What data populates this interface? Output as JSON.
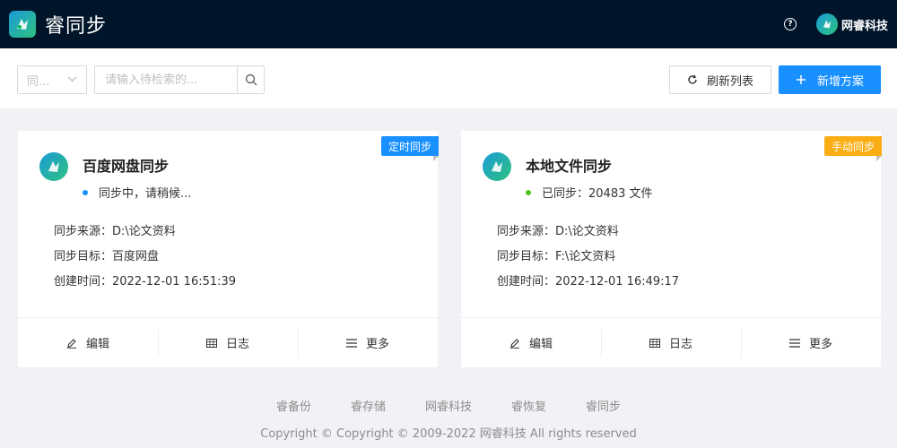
{
  "header": {
    "app_title": "睿同步",
    "logo_icon": "app-logo-icon",
    "user_name": "网睿科技"
  },
  "toolbar": {
    "select_value": "同...",
    "search_placeholder": "请输入待检索的...",
    "refresh_label": "刷新列表",
    "add_label": "新增方案"
  },
  "cards": [
    {
      "ribbon": "定时同步",
      "ribbon_color": "#1890ff",
      "title": "百度网盘同步",
      "status": "同步中，请稍候...",
      "status_color": "#1890ff",
      "source": "同步来源：D:\\论文资料",
      "target": "同步目标：百度网盘",
      "created": "创建时间：2022-12-01 16:51:39",
      "actions": {
        "edit": "编辑",
        "log": "日志",
        "more": "更多"
      }
    },
    {
      "ribbon": "手动同步",
      "ribbon_color": "#faad14",
      "title": "本地文件同步",
      "status": "已同步：20483 文件",
      "status_color": "#52c41a",
      "source": "同步来源：D:\\论文资料",
      "target": "同步目标：F:\\论文资料",
      "created": "创建时间：2022-12-01 16:49:17",
      "actions": {
        "edit": "编辑",
        "log": "日志",
        "more": "更多"
      }
    }
  ],
  "footer": {
    "links": [
      "睿备份",
      "睿存储",
      "网睿科技",
      "睿恢复",
      "睿同步"
    ],
    "copyright": "Copyright © Copyright © 2009-2022 网睿科技 All rights reserved"
  },
  "colors": {
    "header_bg": "#001529",
    "primary": "#1890ff",
    "warning": "#faad14",
    "success": "#52c41a"
  }
}
